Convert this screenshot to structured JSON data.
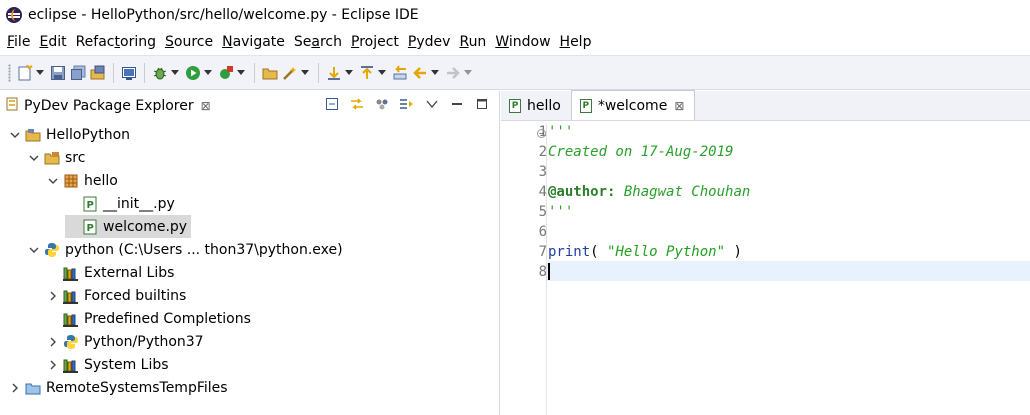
{
  "window": {
    "title": "eclipse - HelloPython/src/hello/welcome.py - Eclipse IDE"
  },
  "menu": [
    {
      "mn": "F",
      "rest": "ile"
    },
    {
      "mn": "E",
      "rest": "dit"
    },
    {
      "pre": "Refac",
      "mn": "t",
      "rest": "oring"
    },
    {
      "mn": "S",
      "rest": "ource"
    },
    {
      "mn": "N",
      "rest": "avigate"
    },
    {
      "pre": "Se",
      "mn": "a",
      "rest": "rch"
    },
    {
      "mn": "P",
      "rest": "roject"
    },
    {
      "mn": "P",
      "rest": "ydev"
    },
    {
      "mn": "R",
      "rest": "un"
    },
    {
      "mn": "W",
      "rest": "indow"
    },
    {
      "mn": "H",
      "rest": "elp"
    }
  ],
  "explorer": {
    "title": "PyDev Package Explorer",
    "tree": [
      {
        "label": "HelloPython",
        "level": 0,
        "toggle": "expanded",
        "icon": "project-folder-icon"
      },
      {
        "label": "src",
        "level": 1,
        "toggle": "expanded",
        "icon": "source-folder-icon"
      },
      {
        "label": "hello",
        "level": 2,
        "toggle": "expanded",
        "icon": "package-icon"
      },
      {
        "label": "__init__.py",
        "level": 3,
        "toggle": "none",
        "icon": "python-file-icon"
      },
      {
        "label": "welcome.py",
        "level": 3,
        "toggle": "none",
        "icon": "python-file-icon",
        "selected": true
      },
      {
        "label": "python  (C:\\Users ... thon37\\python.exe)",
        "level": 1,
        "toggle": "expanded",
        "icon": "python-interpreter-icon"
      },
      {
        "label": "External Libs",
        "level": 2,
        "toggle": "none",
        "icon": "library-icon"
      },
      {
        "label": "Forced builtins",
        "level": 2,
        "toggle": "collapsed",
        "icon": "library-icon"
      },
      {
        "label": "Predefined Completions",
        "level": 2,
        "toggle": "none",
        "icon": "library-icon"
      },
      {
        "label": "Python/Python37",
        "level": 2,
        "toggle": "collapsed",
        "icon": "python-interpreter-icon"
      },
      {
        "label": "System Libs",
        "level": 2,
        "toggle": "collapsed",
        "icon": "library-icon"
      },
      {
        "label": "RemoteSystemsTempFiles",
        "level": 0,
        "toggle": "collapsed",
        "icon": "folder-icon"
      }
    ]
  },
  "editor": {
    "tabs": [
      {
        "label": "hello",
        "active": false
      },
      {
        "label": "*welcome",
        "active": true
      }
    ],
    "line_numbers": [
      "1",
      "2",
      "3",
      "4",
      "5",
      "6",
      "7",
      "8"
    ],
    "code": {
      "l1": "'''",
      "l2": "Created on 17-Aug-2019",
      "l4_tag": "@author:",
      "l4_name": " Bhagwat Chouhan",
      "l5": "'''",
      "l7_fn": "print",
      "l7_open": "( ",
      "l7_str": "\"Hello Python\"",
      "l7_close": " )"
    }
  },
  "colors": {
    "toolbar_bg": "#f1f3f9",
    "docstring": "#2a9f2a",
    "keyword": "#1f3ea8",
    "current_line": "#e8f2fe"
  }
}
